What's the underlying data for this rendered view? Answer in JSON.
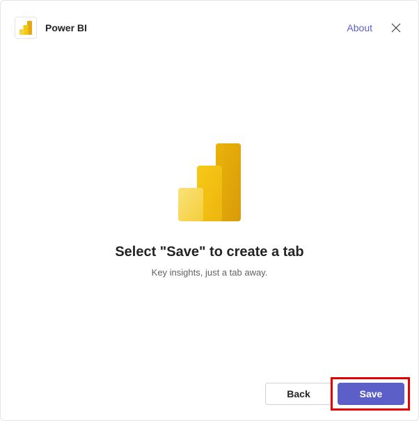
{
  "header": {
    "app_name": "Power BI",
    "about_label": "About"
  },
  "content": {
    "heading": "Select \"Save\" to create a tab",
    "subtitle": "Key insights, just a tab away."
  },
  "footer": {
    "back_label": "Back",
    "save_label": "Save"
  },
  "colors": {
    "primary": "#5b5fc7",
    "highlight": "#e60000",
    "icon_dark": "#e6a817",
    "icon_mid": "#f2c811",
    "icon_light": "#f5d342"
  }
}
